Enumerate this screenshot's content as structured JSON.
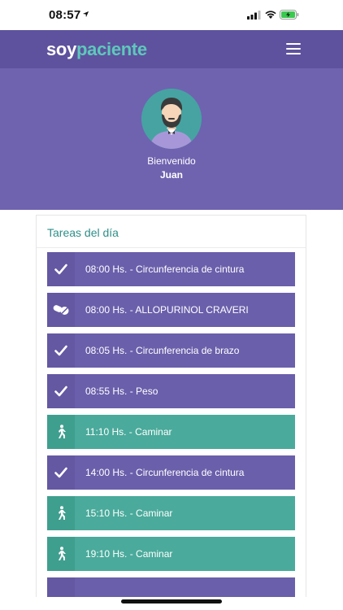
{
  "status_bar": {
    "time": "08:57"
  },
  "header": {
    "logo_part1": "soy",
    "logo_part2": "paciente"
  },
  "profile": {
    "welcome": "Bienvenido",
    "name": "Juan"
  },
  "tasks_card": {
    "title": "Tareas del día",
    "items": [
      {
        "label": "08:00 Hs. - Circunferencia de cintura",
        "icon": "check-icon",
        "color": "purple"
      },
      {
        "label": "08:00 Hs. - ALLOPURINOL CRAVERI",
        "icon": "pill-icon",
        "color": "purple"
      },
      {
        "label": "08:05 Hs. - Circunferencia de brazo",
        "icon": "check-icon",
        "color": "purple"
      },
      {
        "label": "08:55 Hs. - Peso",
        "icon": "check-icon",
        "color": "purple"
      },
      {
        "label": "11:10 Hs. - Caminar",
        "icon": "walk-icon",
        "color": "teal"
      },
      {
        "label": "14:00 Hs. - Circunferencia de cintura",
        "icon": "check-icon",
        "color": "purple"
      },
      {
        "label": "15:10 Hs. - Caminar",
        "icon": "walk-icon",
        "color": "teal"
      },
      {
        "label": "19:10 Hs. - Caminar",
        "icon": "walk-icon",
        "color": "teal"
      }
    ]
  },
  "colors": {
    "header": "#5e529e",
    "hero": "#6f63b0",
    "task_purple": "#6a5fab",
    "task_teal": "#4aaa9b",
    "accent_teal": "#5ec8bb"
  }
}
